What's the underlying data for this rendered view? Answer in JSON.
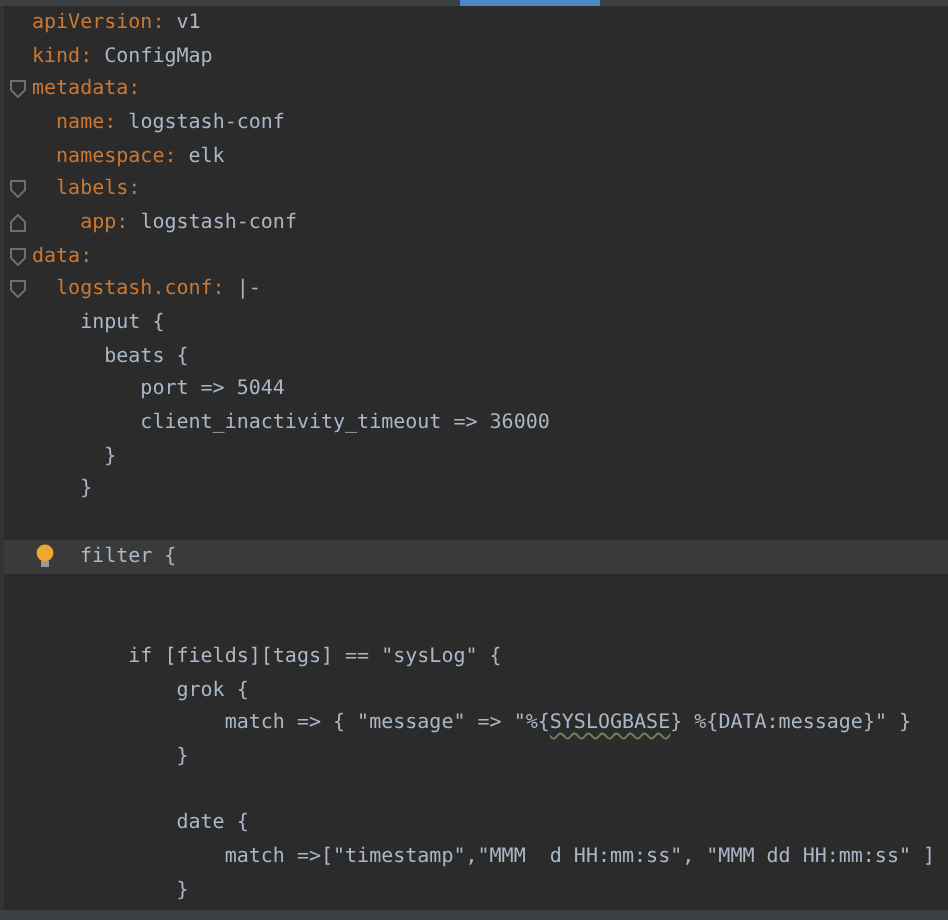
{
  "editor": {
    "lines": [
      {
        "kind": "plain",
        "current": false,
        "segments": [
          {
            "kind": "key",
            "text": "apiVersion:"
          },
          {
            "kind": "plain",
            "text": " v1"
          }
        ]
      },
      {
        "kind": "plain",
        "current": false,
        "segments": [
          {
            "kind": "key",
            "text": "kind:"
          },
          {
            "kind": "plain",
            "text": " ConfigMap"
          }
        ]
      },
      {
        "kind": "fold_start",
        "current": false,
        "segments": [
          {
            "kind": "key",
            "text": "metadata:"
          }
        ]
      },
      {
        "kind": "plain",
        "current": false,
        "segments": [
          {
            "kind": "key",
            "text": "  name:"
          },
          {
            "kind": "plain",
            "text": " logstash-conf"
          }
        ]
      },
      {
        "kind": "plain",
        "current": false,
        "segments": [
          {
            "kind": "key",
            "text": "  namespace:"
          },
          {
            "kind": "plain",
            "text": " elk"
          }
        ]
      },
      {
        "kind": "fold_start",
        "current": false,
        "segments": [
          {
            "kind": "key",
            "text": "  labels:"
          }
        ]
      },
      {
        "kind": "fold_end",
        "current": false,
        "segments": [
          {
            "kind": "key",
            "text": "    app:"
          },
          {
            "kind": "plain",
            "text": " logstash-conf"
          }
        ]
      },
      {
        "kind": "fold_start",
        "current": false,
        "segments": [
          {
            "kind": "key",
            "text": "data:"
          }
        ]
      },
      {
        "kind": "fold_start",
        "current": false,
        "segments": [
          {
            "kind": "key",
            "text": "  logstash.conf:"
          },
          {
            "kind": "plain",
            "text": " |-"
          }
        ]
      },
      {
        "kind": "plain",
        "current": false,
        "segments": [
          {
            "kind": "plain",
            "text": "    input {"
          }
        ]
      },
      {
        "kind": "plain",
        "current": false,
        "segments": [
          {
            "kind": "plain",
            "text": "      beats {"
          }
        ]
      },
      {
        "kind": "plain",
        "current": false,
        "segments": [
          {
            "kind": "plain",
            "text": "         port => 5044"
          }
        ]
      },
      {
        "kind": "plain",
        "current": false,
        "segments": [
          {
            "kind": "plain",
            "text": "         client_inactivity_timeout => 36000"
          }
        ]
      },
      {
        "kind": "plain",
        "current": false,
        "segments": [
          {
            "kind": "plain",
            "text": "      }"
          }
        ]
      },
      {
        "kind": "plain",
        "current": false,
        "segments": [
          {
            "kind": "plain",
            "text": "    }"
          }
        ]
      },
      {
        "kind": "plain",
        "current": false
      },
      {
        "kind": "plain",
        "current": true,
        "bulb": true,
        "segments": [
          {
            "kind": "plain",
            "text": "  filter {"
          }
        ]
      },
      {
        "kind": "plain",
        "current": false
      },
      {
        "kind": "plain",
        "current": false
      },
      {
        "kind": "plain",
        "current": false,
        "segments": [
          {
            "kind": "plain",
            "text": "        if [fields][tags] == \"sysLog\" {"
          }
        ]
      },
      {
        "kind": "plain",
        "current": false,
        "segments": [
          {
            "kind": "plain",
            "text": "            grok {"
          }
        ]
      },
      {
        "kind": "plain",
        "current": false,
        "segments": [
          {
            "kind": "plain",
            "text": "                match => { \"message\" => \"%{"
          },
          {
            "kind": "warning",
            "text": "SYSLOGBASE"
          },
          {
            "kind": "plain",
            "text": "} %{DATA:message}\" }"
          }
        ]
      },
      {
        "kind": "plain",
        "current": false,
        "segments": [
          {
            "kind": "plain",
            "text": "            }"
          }
        ]
      },
      {
        "kind": "plain",
        "current": false
      },
      {
        "kind": "plain",
        "current": false,
        "segments": [
          {
            "kind": "plain",
            "text": "            date {"
          }
        ]
      },
      {
        "kind": "plain",
        "current": false,
        "segments": [
          {
            "kind": "plain",
            "text": "                match =>[\"timestamp\",\"MMM  d HH:mm:ss\", \"MMM dd HH:mm:ss\" ]"
          }
        ]
      },
      {
        "kind": "plain",
        "current": false,
        "segments": [
          {
            "kind": "plain",
            "text": "            }"
          }
        ]
      }
    ]
  }
}
